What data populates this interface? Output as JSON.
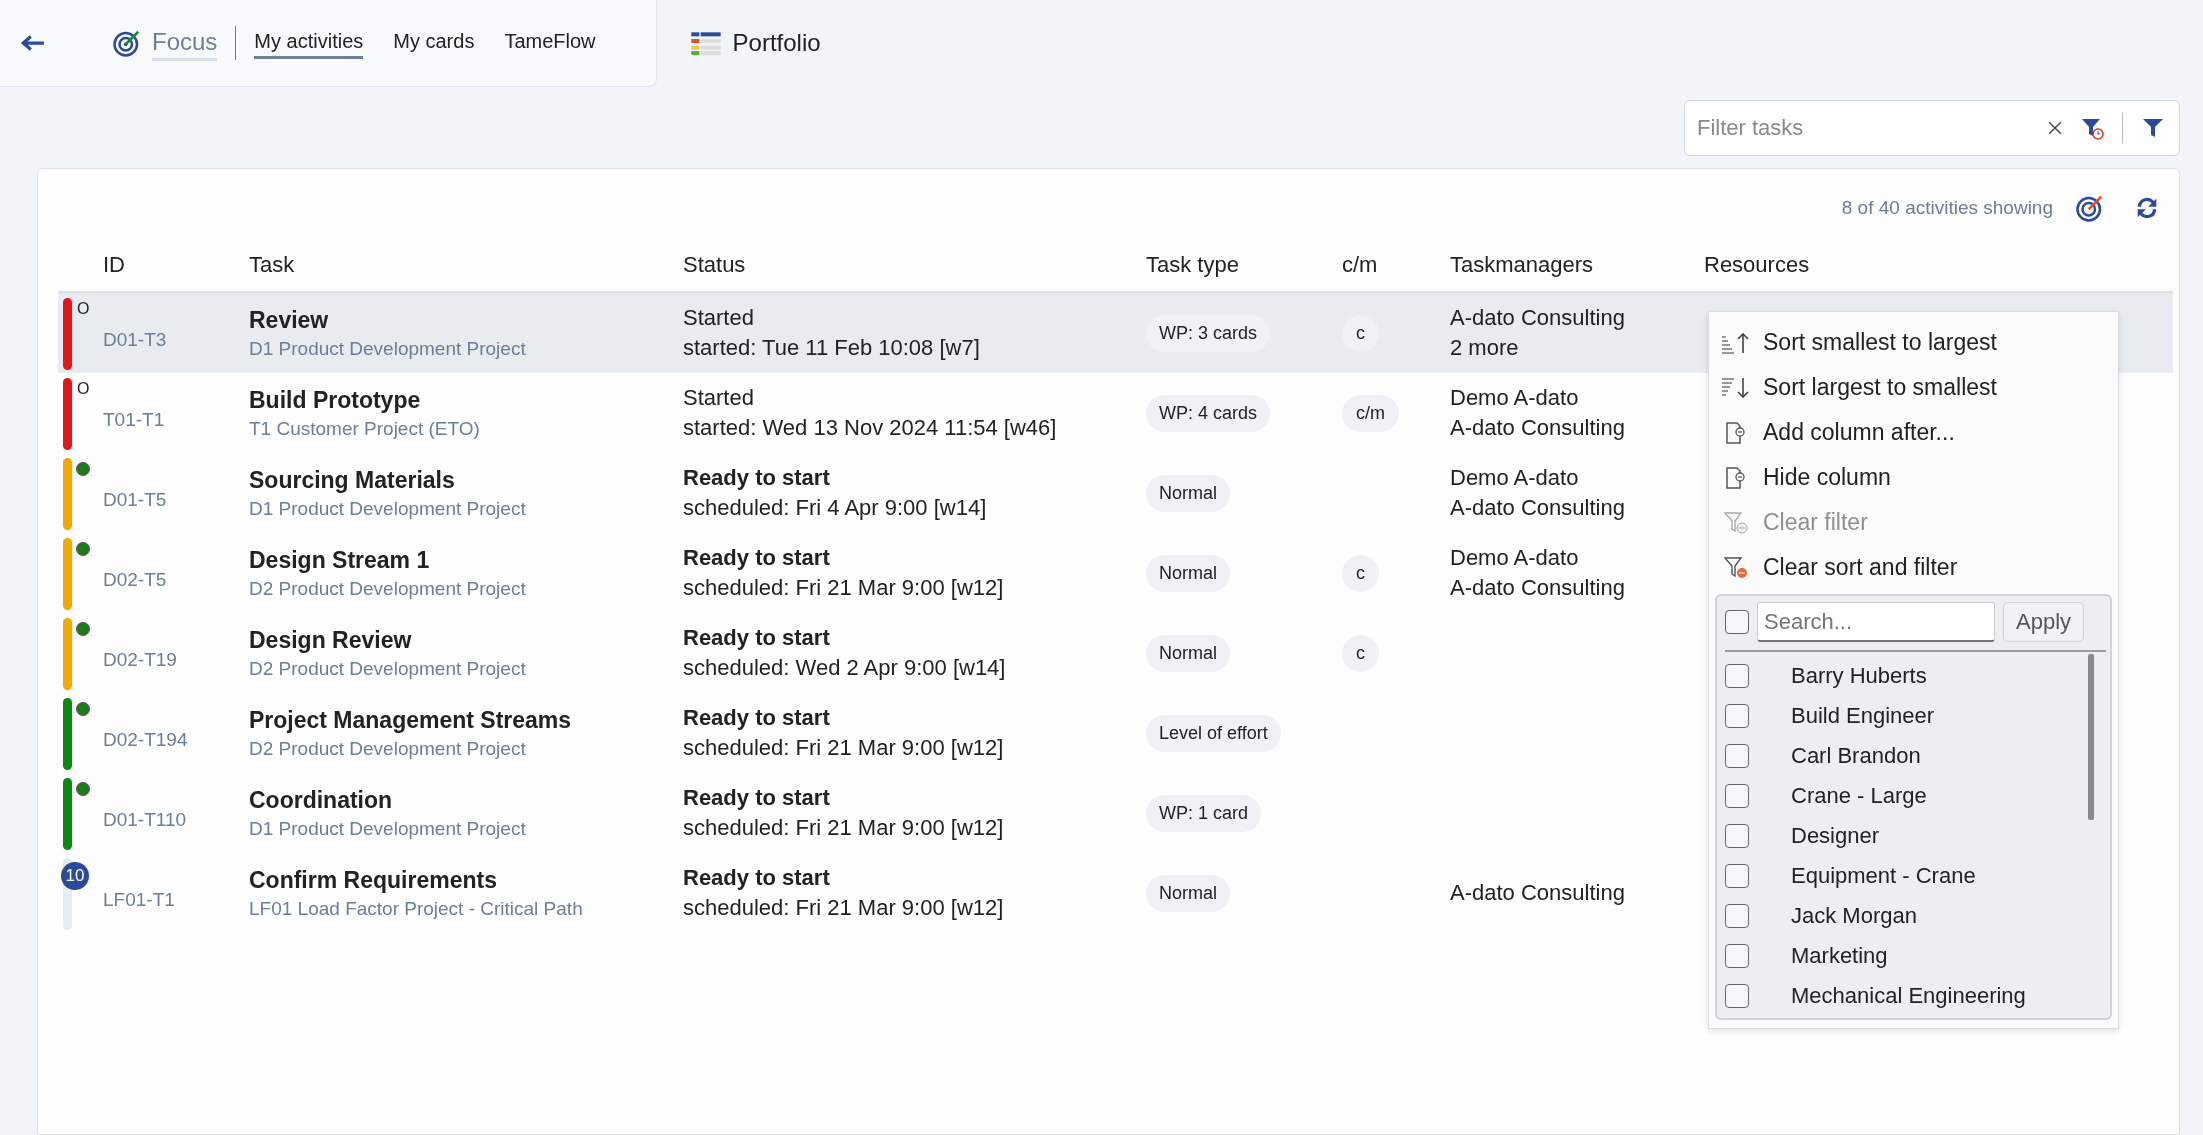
{
  "nav": {
    "focus": "Focus",
    "tabs": [
      {
        "label": "My activities",
        "selected": true
      },
      {
        "label": "My cards",
        "selected": false
      },
      {
        "label": "TameFlow",
        "selected": false
      }
    ],
    "portfolio": "Portfolio"
  },
  "filter": {
    "placeholder": "Filter tasks"
  },
  "summary": "8 of 40 activities showing",
  "table": {
    "columns": [
      "ID",
      "Task",
      "Status",
      "Task type",
      "c/m",
      "Taskmanagers",
      "Resources"
    ],
    "rows": [
      {
        "selected": true,
        "color": "#e8141c",
        "marker": {
          "kind": "letter",
          "text": "O"
        },
        "id": "D01-T3",
        "task": "Review",
        "project": "D1 Product Development Project",
        "status": "Started",
        "status_bold": false,
        "date": "started: Tue 11 Feb 10:08 [w7]",
        "type": "WP: 3 cards",
        "cm": "c",
        "managers": [
          "A-dato Consulting",
          "2 more"
        ]
      },
      {
        "selected": false,
        "color": "#e8141c",
        "marker": {
          "kind": "letter",
          "text": "O"
        },
        "id": "T01-T1",
        "task": "Build Prototype",
        "project": "T1 Customer Project (ETO)",
        "status": "Started",
        "status_bold": false,
        "date": "started: Wed 13 Nov 2024 11:54 [w46]",
        "type": "WP: 4 cards",
        "cm": "c/m",
        "managers": [
          "Demo A-dato",
          "A-dato Consulting"
        ]
      },
      {
        "selected": false,
        "color": "#f5a800",
        "marker": {
          "kind": "dot"
        },
        "id": "D01-T5",
        "task": "Sourcing Materials",
        "project": "D1 Product Development Project",
        "status": "Ready to start",
        "status_bold": true,
        "date": "scheduled: Fri 4 Apr 9:00 [w14]",
        "type": "Normal",
        "managers": [
          "Demo A-dato",
          "A-dato Consulting"
        ]
      },
      {
        "selected": false,
        "color": "#f5a800",
        "marker": {
          "kind": "dot"
        },
        "id": "D02-T5",
        "task": "Design Stream 1",
        "project": "D2 Product Development Project",
        "status": "Ready to start",
        "status_bold": true,
        "date": "scheduled: Fri 21 Mar 9:00 [w12]",
        "type": "Normal",
        "cm": "c",
        "managers": [
          "Demo A-dato",
          "A-dato Consulting"
        ]
      },
      {
        "selected": false,
        "color": "#f5a800",
        "marker": {
          "kind": "dot"
        },
        "id": "D02-T19",
        "task": "Design Review",
        "project": "D2 Product Development Project",
        "status": "Ready to start",
        "status_bold": true,
        "date": "scheduled: Wed 2 Apr 9:00 [w14]",
        "type": "Normal",
        "cm": "c",
        "managers": []
      },
      {
        "selected": false,
        "color": "#0a8a12",
        "marker": {
          "kind": "dot"
        },
        "id": "D02-T194",
        "task": "Project Management Streams",
        "project": "D2 Product Development Project",
        "status": "Ready to start",
        "status_bold": true,
        "date": "scheduled: Fri 21 Mar 9:00 [w12]",
        "type": "Level of effort",
        "managers": []
      },
      {
        "selected": false,
        "color": "#0a8a12",
        "marker": {
          "kind": "dot"
        },
        "id": "D01-T110",
        "task": "Coordination",
        "project": "D1 Product Development Project",
        "status": "Ready to start",
        "status_bold": true,
        "date": "scheduled: Fri 21 Mar 9:00 [w12]",
        "type": "WP: 1 card",
        "managers": []
      },
      {
        "selected": false,
        "color": "#e6ebf3",
        "marker": {
          "kind": "badge",
          "text": "10"
        },
        "id": "LF01-T1",
        "task": "Confirm Requirements",
        "project": "LF01 Load Factor Project - Critical Path",
        "status": "Ready to start",
        "status_bold": true,
        "date": "scheduled: Fri 21 Mar 9:00 [w12]",
        "type": "Normal",
        "managers": [
          "A-dato Consulting"
        ]
      }
    ]
  },
  "menu": {
    "items": [
      {
        "label": "Sort smallest to largest",
        "kind": "sort",
        "disabled": false
      },
      {
        "label": "Sort largest to smallest",
        "kind": "sort",
        "disabled": false
      },
      {
        "label": "Add column after...",
        "kind": "column",
        "disabled": false
      },
      {
        "label": "Hide column",
        "kind": "column",
        "disabled": false
      },
      {
        "label": "Clear filter",
        "kind": "filter",
        "disabled": true
      },
      {
        "label": "Clear sort and filter",
        "kind": "filter",
        "disabled": false
      }
    ],
    "select_all_checked": false,
    "search_placeholder": "Search...",
    "apply": "Apply",
    "options": [
      {
        "label": "Barry Huberts",
        "checked": false
      },
      {
        "label": "Build Engineer",
        "checked": false
      },
      {
        "label": "Carl Brandon",
        "checked": false
      },
      {
        "label": "Crane - Large",
        "checked": false
      },
      {
        "label": "Designer",
        "checked": false
      },
      {
        "label": "Equipment - Crane",
        "checked": false
      },
      {
        "label": "Jack Morgan",
        "checked": false
      },
      {
        "label": "Marketing",
        "checked": false
      },
      {
        "label": "Mechanical Engineering",
        "checked": false
      }
    ]
  }
}
